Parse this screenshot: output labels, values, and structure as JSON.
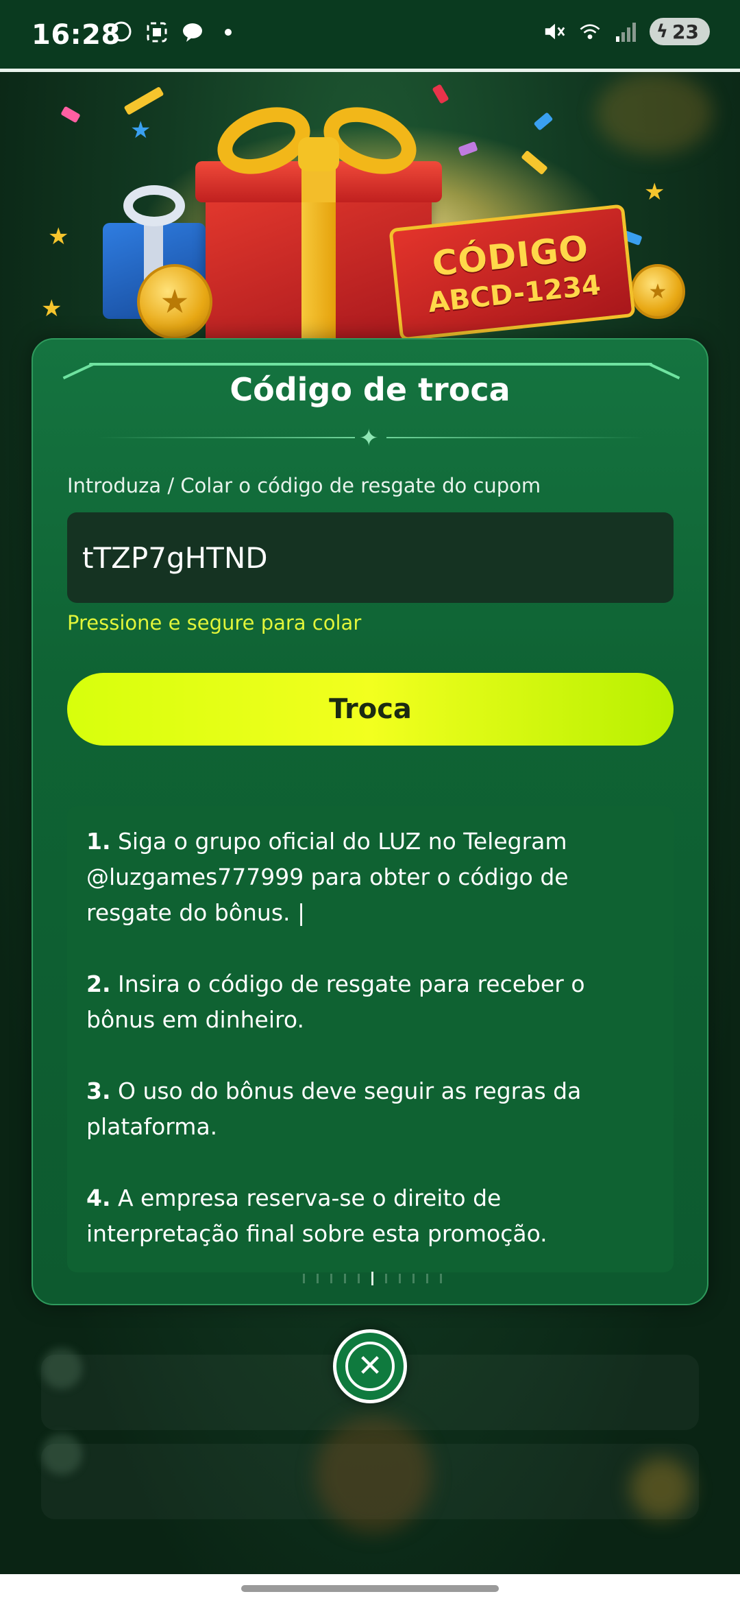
{
  "status_bar": {
    "time": "16:28",
    "left_icons": [
      "whatsapp-icon",
      "screenshot-icon",
      "chat-icon",
      "dot-icon"
    ],
    "right_icons": [
      "mute-icon",
      "wifi-icon",
      "signal-icon"
    ],
    "battery_level": "23",
    "battery_charging": true
  },
  "banner": {
    "ticket_title": "CÓDIGO",
    "ticket_code": "ABCD-1234"
  },
  "dialog": {
    "title": "Código de troca",
    "input_label": "Introduza / Colar o código de resgate do cupom",
    "input_value": "tTZP7gHTND",
    "hint": "Pressione e segure para colar",
    "submit_label": "Troca",
    "rules": [
      {
        "num": "1.",
        "text": " Siga o grupo oficial do LUZ no Telegram @luzgames777999 para obter o código de resgate do bônus. |"
      },
      {
        "num": "2.",
        "text": " Insira o código de resgate para receber o bônus em dinheiro."
      },
      {
        "num": "3.",
        "text": " O uso do bônus deve seguir as regras da plataforma."
      },
      {
        "num": "4.",
        "text": " A empresa reserva-se o direito de interpretação final sobre esta promoção."
      }
    ]
  },
  "colors": {
    "card_green": "#0f6334",
    "accent_lime": "#e1f53a",
    "button_lime": "#d7ff0c",
    "input_bg": "#153322"
  }
}
